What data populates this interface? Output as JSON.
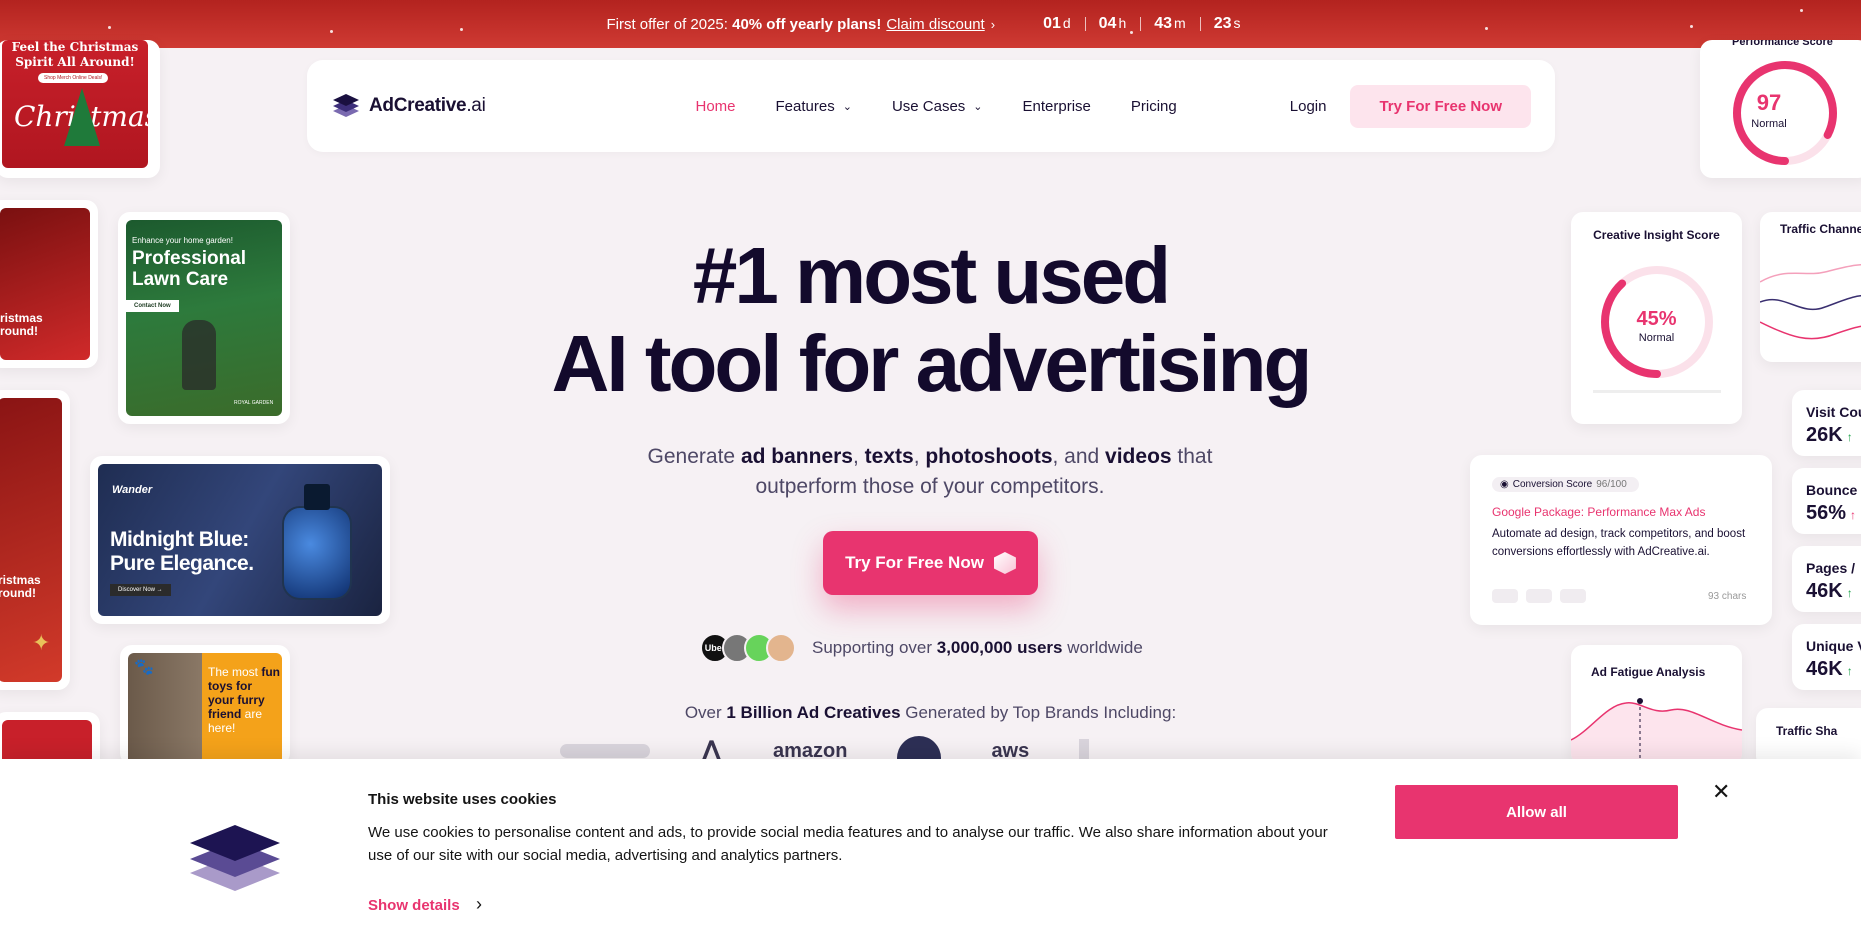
{
  "promo": {
    "prefix": "First offer of 2025: ",
    "bold": "40% off yearly plans!",
    "claim": "Claim discount",
    "timer": [
      {
        "num": "01",
        "unit": "d"
      },
      {
        "num": "04",
        "unit": "h"
      },
      {
        "num": "43",
        "unit": "m"
      },
      {
        "num": "23",
        "unit": "s"
      }
    ]
  },
  "nav": {
    "logo_bold": "AdCreative",
    "logo_light": ".ai",
    "items": [
      {
        "label": "Home",
        "active": true,
        "dropdown": false
      },
      {
        "label": "Features",
        "active": false,
        "dropdown": true
      },
      {
        "label": "Use Cases",
        "active": false,
        "dropdown": true
      },
      {
        "label": "Enterprise",
        "active": false,
        "dropdown": false
      },
      {
        "label": "Pricing",
        "active": false,
        "dropdown": false
      }
    ],
    "login": "Login",
    "try": "Try For Free Now"
  },
  "hero": {
    "line1": "#1 most used",
    "line2": "AI tool for advertising",
    "sub_parts": [
      "Generate ",
      "ad banners",
      ", ",
      "texts",
      ", ",
      "photoshoots",
      ", and ",
      "videos",
      " that outperform those of your competitors."
    ],
    "cta": "Try For Free Now",
    "users_pre": "Supporting over ",
    "users_bold": "3,000,000 users",
    "users_post": " worldwide",
    "avatars": [
      "Uber",
      "",
      "",
      ""
    ],
    "brands_pre": "Over ",
    "brands_bold": "1 Billion Ad Creatives",
    "brands_post": " Generated by Top Brands Including:",
    "brands": [
      "amazon",
      "aws"
    ]
  },
  "left_ads": {
    "christmas_title": "Feel the Christmas Spirit All Around!",
    "christmas_btn": "Shop Merch Online Deals!",
    "christmas_word": "Christmas",
    "lawn_small": "Enhance your home garden!",
    "lawn_title": "Professional Lawn Care",
    "lawn_btn": "Contact Now",
    "lawn_brand": "ROYAL GARDEN",
    "side_text_1": "ristmas\nround!",
    "side_text_2": "ristmas\nround!",
    "perfume_brand": "Wander",
    "perfume_title": "Midnight Blue: Pure Elegance.",
    "perfume_btn": "Discover Now →",
    "toys_text_parts": [
      "The most ",
      "fun toys for your furry friend",
      " are here!"
    ]
  },
  "right_widgets": {
    "perf_title": "Performance Score",
    "perf_value": "97",
    "perf_label": "Normal",
    "perf_level": 0.97,
    "insight_title": "Creative Insight Score",
    "insight_value": "45%",
    "insight_label": "Normal",
    "insight_level": 0.45,
    "traffic_title": "Traffic Channel",
    "conversion_badge": "Conversion Score",
    "conversion_value": "96/100",
    "conversion_heading": "Google Package: Performance Max Ads",
    "conversion_text": "Automate ad design, track competitors, and boost conversions effortlessly with AdCreative.ai.",
    "conversion_chars": "93 chars",
    "fatigue_title": "Ad Fatigue Analysis",
    "traffic_share_title": "Traffic Sha",
    "metrics": [
      {
        "label": "Visit Cou",
        "value": "26K",
        "arrow": "↑",
        "arrow_color": "#1fa34a"
      },
      {
        "label": "Bounce R",
        "value": "56%",
        "arrow": "↑",
        "arrow_color": "#e8346f"
      },
      {
        "label": "Pages /",
        "value": "46K",
        "arrow": "↑",
        "arrow_color": "#1fa34a"
      },
      {
        "label": "Unique V",
        "value": "46K",
        "arrow": "↑",
        "arrow_color": "#1fa34a"
      }
    ]
  },
  "cookie": {
    "title": "This website uses cookies",
    "body": "We use cookies to personalise content and ads, to provide social media features and to analyse our traffic. We also share information about your use of our site with our social media, advertising and analytics partners.",
    "show": "Show details",
    "allow": "Allow all"
  },
  "colors": {
    "accent": "#e8346f",
    "promo": "#c22e28",
    "dark": "#130a2c"
  }
}
